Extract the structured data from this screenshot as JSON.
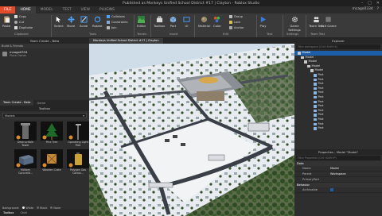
{
  "window": {
    "title": "Published as Monkeys Unified School District #17 | Clayton - Roblox Studio"
  },
  "menu": {
    "file": "FILE",
    "tabs": [
      "HOME",
      "MODEL",
      "TEST",
      "VIEW",
      "PLUGINS"
    ],
    "active_tab": "HOME"
  },
  "user": {
    "name": "mcago0334",
    "help": "?"
  },
  "ribbon": {
    "clipboard": {
      "paste": "Paste",
      "copy": "Copy",
      "cut": "Cut",
      "duplicate": "Duplicate",
      "group_label": "Clipboard"
    },
    "tools": {
      "select": "Select",
      "move": "Move",
      "scale": "Scale",
      "rotate": "Rotate",
      "collisions": "Collisions",
      "constraints": "Constraints",
      "join": "Join",
      "group_label": "Tools"
    },
    "terrain": {
      "editor": "Editor",
      "group_label": "Terrain"
    },
    "insert": {
      "toolbox": "Toolbox",
      "part": "Part",
      "ui": "UI",
      "group_label": "Insert"
    },
    "edit": {
      "material": "Material",
      "color": "Color",
      "group": "Group",
      "lock": "Lock",
      "anchor": "Anchor",
      "group_label": "Edit"
    },
    "test": {
      "play": "Play",
      "group_label": "Test"
    },
    "settings": {
      "game_settings": "Game Settings",
      "group_label": "Settings"
    },
    "team_test": {
      "team_test": "Team Test",
      "exit_game": "Exit Game",
      "group_label": "Team Test"
    }
  },
  "team_create": {
    "header": "Team Create - Beta",
    "subheader": "Build & Friends",
    "player_name": "mcago0334",
    "player_status": "Place Owner"
  },
  "toolbox": {
    "tabs": [
      "Team Create - Beta",
      "Game"
    ],
    "header": "Toolbox",
    "category": "Models",
    "items": [
      {
        "label": "Destructible Tower",
        "icon": "tower-model-icon"
      },
      {
        "label": "Pine Tree",
        "icon": "pine-tree-icon"
      },
      {
        "label": "Operating Light Pole",
        "icon": "light-pole-icon"
      },
      {
        "label": "Military Concrete...",
        "icon": "concrete-block-icon"
      },
      {
        "label": "Wooden Crate",
        "icon": "crate-icon"
      },
      {
        "label": "Polygon Gas Contai...",
        "icon": "gas-container-icon"
      }
    ],
    "background_label": "Background:",
    "bg_options": [
      "White",
      "Black",
      "None"
    ]
  },
  "left_bottom_tabs": [
    "Toolbox",
    "Chat"
  ],
  "viewport": {
    "tabs": [
      "Monkeys Unified School District #17 | Clayton"
    ]
  },
  "explorer": {
    "header": "Explorer",
    "filter_placeholder": "Filter workspace (Ctrl+Shift+X)",
    "nodes": [
      {
        "label": "Model",
        "depth": 0,
        "selected": true
      },
      {
        "label": "Model",
        "depth": 1,
        "selected": false
      },
      {
        "label": "Model",
        "depth": 2,
        "selected": false
      },
      {
        "label": "Model",
        "depth": 3,
        "selected": false
      },
      {
        "label": "Model",
        "depth": 4,
        "selected": false
      },
      {
        "label": "Part",
        "depth": 5,
        "selected": false
      },
      {
        "label": "Part",
        "depth": 5,
        "selected": false
      },
      {
        "label": "Part",
        "depth": 5,
        "selected": false
      },
      {
        "label": "Part",
        "depth": 5,
        "selected": false
      },
      {
        "label": "Part",
        "depth": 5,
        "selected": false
      },
      {
        "label": "Part",
        "depth": 5,
        "selected": false
      },
      {
        "label": "Part",
        "depth": 5,
        "selected": false
      },
      {
        "label": "Part",
        "depth": 5,
        "selected": false
      },
      {
        "label": "Part",
        "depth": 5,
        "selected": false
      },
      {
        "label": "Part",
        "depth": 5,
        "selected": false
      },
      {
        "label": "Part",
        "depth": 5,
        "selected": false
      },
      {
        "label": "Part",
        "depth": 5,
        "selected": false
      },
      {
        "label": "Part",
        "depth": 5,
        "selected": false
      }
    ]
  },
  "properties": {
    "header": "Properties - Model \"Model\"",
    "filter_placeholder": "Filter Properties (Ctrl+Shift+P)",
    "sections": [
      {
        "title": "Data",
        "rows": [
          {
            "key": "Name",
            "value": "Model"
          },
          {
            "key": "Parent",
            "value": "Workspace"
          },
          {
            "key": "PrimaryPart",
            "value": ""
          }
        ]
      },
      {
        "title": "Behavior",
        "rows": [
          {
            "key": "Archivable",
            "value": "checked"
          }
        ]
      }
    ]
  },
  "colors": {
    "file_button": "#e34b2b",
    "selection": "#1c5ea8",
    "ribbon": "#3a3a3a"
  }
}
